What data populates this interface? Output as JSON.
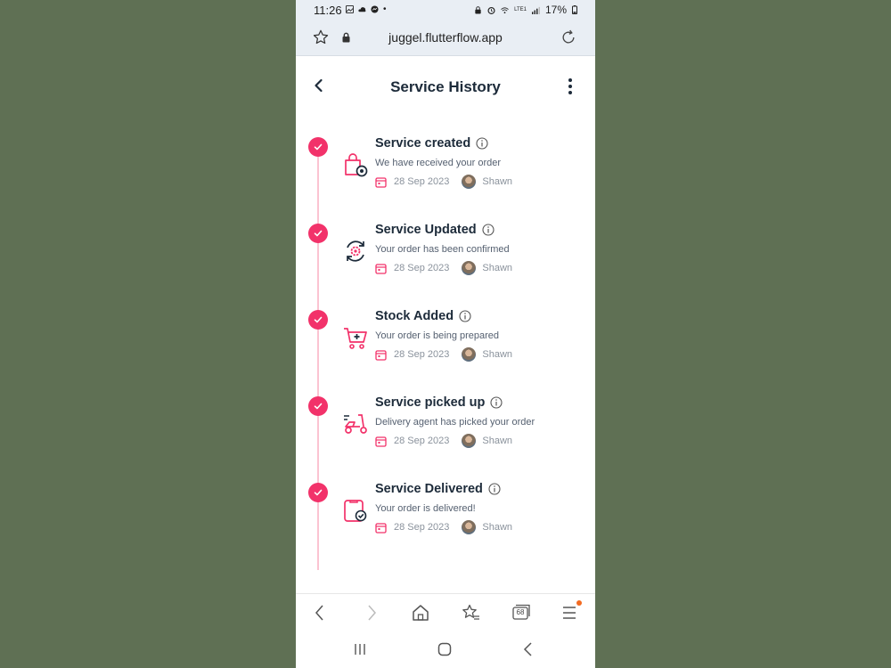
{
  "status_bar": {
    "time": "11:26",
    "battery": "17%",
    "network": "LTE1"
  },
  "browser": {
    "url": "juggel.flutterflow.app",
    "tab_count": "68"
  },
  "header": {
    "title": "Service History"
  },
  "events": [
    {
      "title": "Service created",
      "description": "We have received your order",
      "date": "28 Sep 2023",
      "user": "Shawn",
      "icon": "shopping-bag-gear-icon"
    },
    {
      "title": "Service Updated",
      "description": "Your order has been confirmed",
      "date": "28 Sep 2023",
      "user": "Shawn",
      "icon": "gear-refresh-icon"
    },
    {
      "title": "Stock Added",
      "description": "Your order is being prepared",
      "date": "28 Sep 2023",
      "user": "Shawn",
      "icon": "cart-plus-icon"
    },
    {
      "title": "Service picked up",
      "description": "Delivery agent has picked your order",
      "date": "28 Sep 2023",
      "user": "Shawn",
      "icon": "scooter-icon"
    },
    {
      "title": "Service Delivered",
      "description": "Your order is delivered!",
      "date": "28 Sep 2023",
      "user": "Shawn",
      "icon": "clipboard-check-icon"
    }
  ],
  "colors": {
    "accent": "#f2326a",
    "timeline": "#fbc3d2",
    "title_text": "#1d2b3a",
    "background": "#5f7054"
  }
}
